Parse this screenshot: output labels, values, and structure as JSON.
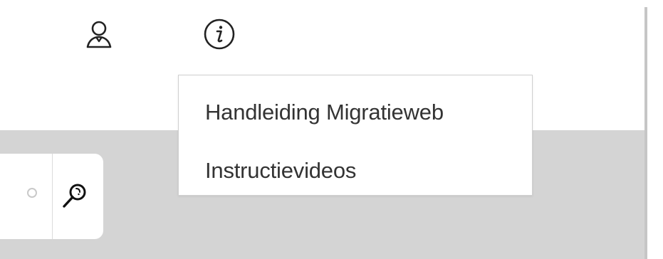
{
  "header": {
    "user_icon": "user-icon",
    "info_icon": "info-icon"
  },
  "info_menu": {
    "items": [
      {
        "label": "Handleiding Migratieweb"
      },
      {
        "label": "Instructievideos"
      }
    ]
  },
  "search": {
    "radio_icon": "radio-unselected-icon",
    "search_icon": "search-icon"
  }
}
